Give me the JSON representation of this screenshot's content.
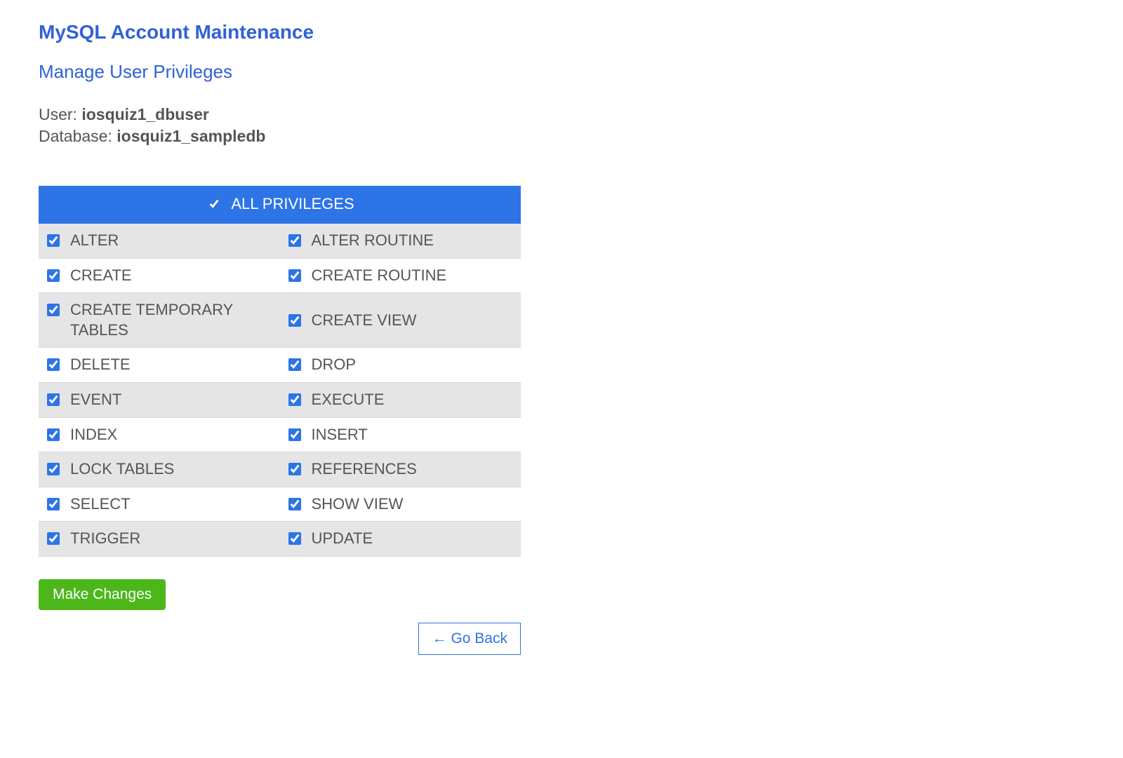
{
  "page_title": "MySQL Account Maintenance",
  "sub_title": "Manage User Privileges",
  "user_label": "User: ",
  "user_value": "iosquiz1_dbuser",
  "db_label": "Database: ",
  "db_value": "iosquiz1_sampledb",
  "all_privileges": {
    "label": "ALL PRIVILEGES",
    "checked": true
  },
  "privileges": [
    {
      "left": "ALTER",
      "right": "ALTER ROUTINE"
    },
    {
      "left": "CREATE",
      "right": "CREATE ROUTINE"
    },
    {
      "left": "CREATE TEMPORARY TABLES",
      "right": "CREATE VIEW"
    },
    {
      "left": "DELETE",
      "right": "DROP"
    },
    {
      "left": "EVENT",
      "right": "EXECUTE"
    },
    {
      "left": "INDEX",
      "right": "INSERT"
    },
    {
      "left": "LOCK TABLES",
      "right": "REFERENCES"
    },
    {
      "left": "SELECT",
      "right": "SHOW VIEW"
    },
    {
      "left": "TRIGGER",
      "right": "UPDATE"
    }
  ],
  "buttons": {
    "make_changes": "Make Changes",
    "go_back": "Go Back",
    "go_back_arrow": "←"
  }
}
